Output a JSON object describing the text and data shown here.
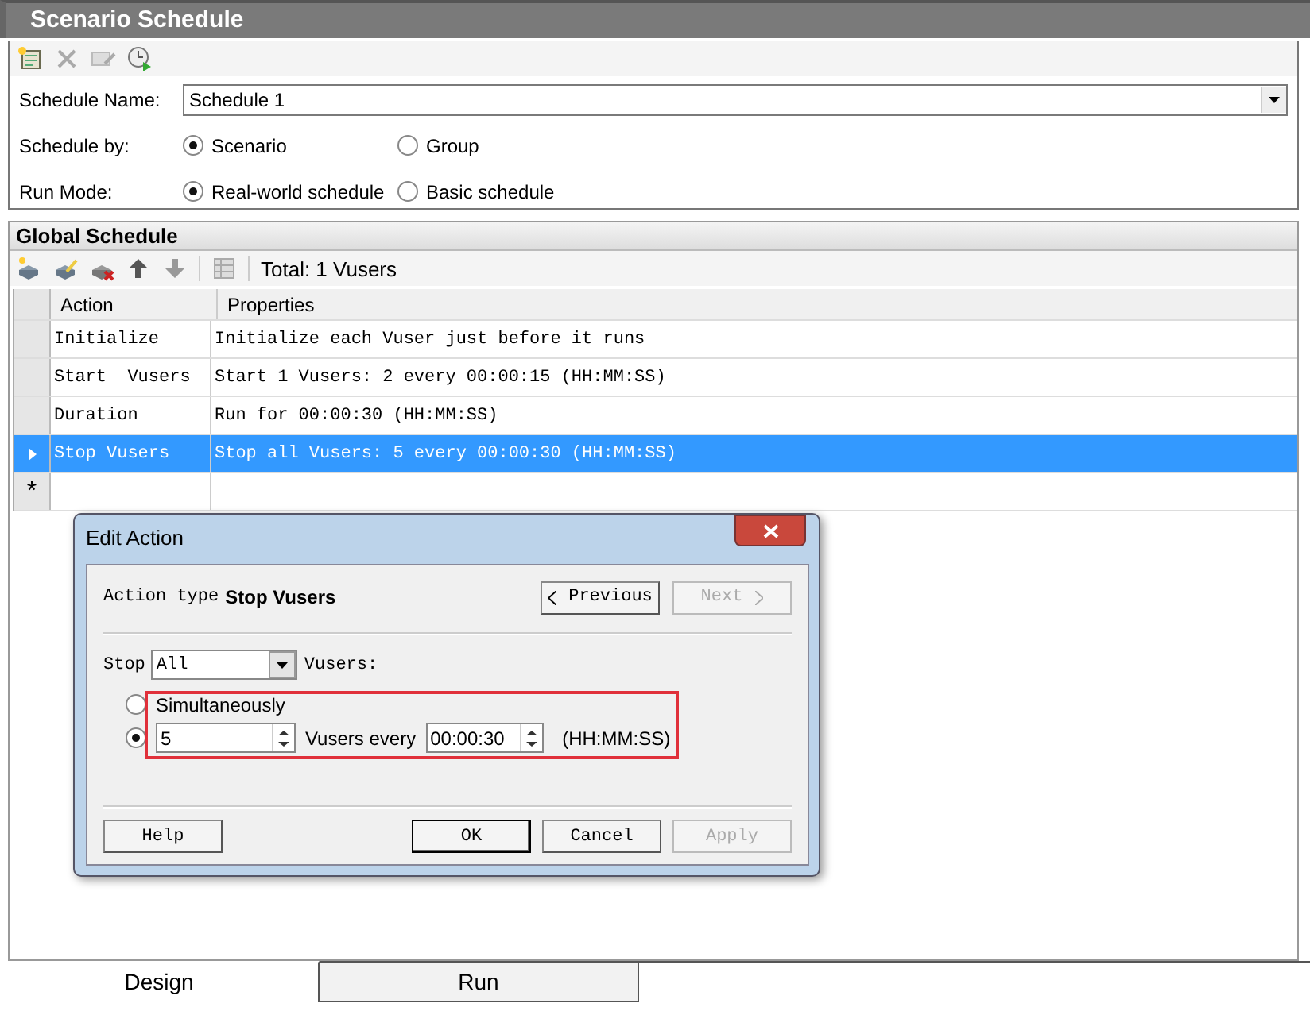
{
  "window": {
    "title": "Scenario Schedule"
  },
  "schedule_form": {
    "name_label": "Schedule Name:",
    "name_value": "Schedule 1",
    "schedule_by": {
      "label": "Schedule by:",
      "options": [
        {
          "label": "Scenario",
          "selected": true
        },
        {
          "label": "Group",
          "selected": false
        }
      ]
    },
    "run_mode": {
      "label": "Run Mode:",
      "options": [
        {
          "label": "Real-world schedule",
          "selected": true
        },
        {
          "label": "Basic schedule",
          "selected": false
        }
      ]
    }
  },
  "global_schedule": {
    "title": "Global Schedule",
    "total": "Total: 1 Vusers",
    "table": {
      "columns": [
        "Action",
        "Properties"
      ],
      "rows": [
        {
          "action": "Initialize",
          "properties": "Initialize each Vuser just before it runs",
          "selected": false
        },
        {
          "action": "Start  Vusers",
          "properties": "Start 1 Vusers: 2 every 00:00:15 (HH:MM:SS)",
          "selected": false
        },
        {
          "action": "Duration",
          "properties": "Run for 00:00:30 (HH:MM:SS)",
          "selected": false
        },
        {
          "action": "Stop Vusers",
          "properties": "Stop all Vusers: 5 every 00:00:30 (HH:MM:SS)",
          "selected": true
        }
      ],
      "new_row_marker": "*"
    }
  },
  "dialog": {
    "title": "Edit Action",
    "action_type_label": "Action type",
    "action_type": "Stop Vusers",
    "nav_buttons": [
      {
        "label": "Previous",
        "disabled": false
      },
      {
        "label": "Next",
        "disabled": true
      }
    ],
    "stop_label": "Stop",
    "stop_value": "All",
    "vusers_label": "Vusers:",
    "options": [
      {
        "kind": "simultaneous",
        "label": "Simultaneously",
        "selected": false
      },
      {
        "kind": "batch",
        "count": "5",
        "every_label": "Vusers every",
        "interval": "00:00:30",
        "format": "(HH:MM:SS)",
        "selected": true
      }
    ],
    "buttons": [
      {
        "label": "Help",
        "disabled": false,
        "default": false
      },
      {
        "label": "OK",
        "disabled": false,
        "default": true
      },
      {
        "label": "Cancel",
        "disabled": false,
        "default": false
      },
      {
        "label": "Apply",
        "disabled": true,
        "default": false
      }
    ]
  },
  "bottom_tabs": [
    {
      "label": "Design",
      "selected": true
    },
    {
      "label": "Run",
      "selected": false
    }
  ]
}
